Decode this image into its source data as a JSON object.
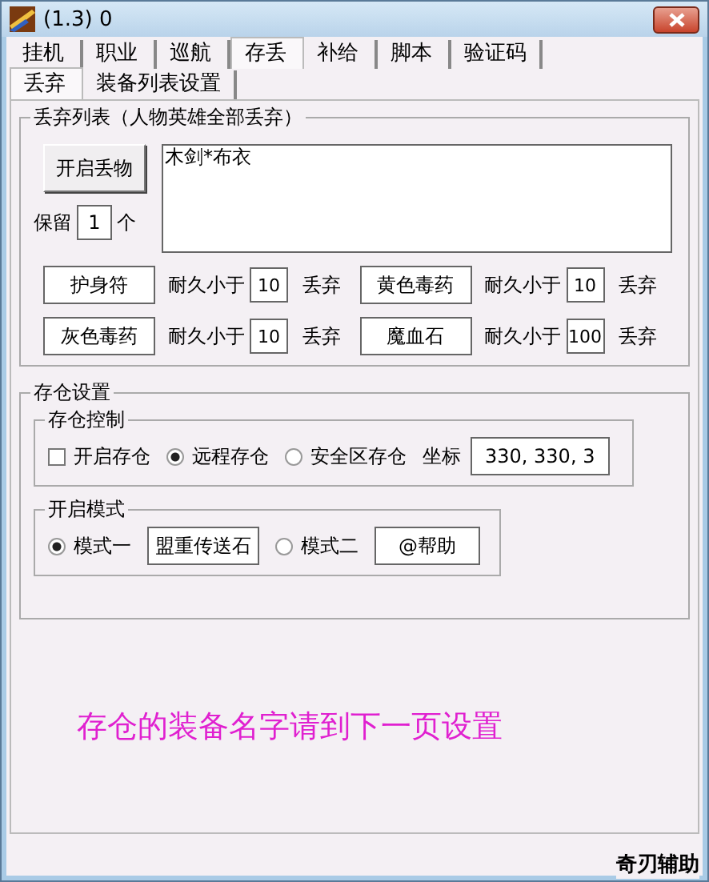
{
  "window": {
    "title": "(1.3) 0"
  },
  "tabs": [
    {
      "label": "挂机",
      "selected": false
    },
    {
      "label": "职业",
      "selected": false
    },
    {
      "label": "巡航",
      "selected": false
    },
    {
      "label": "存丢",
      "selected": true
    },
    {
      "label": "补给",
      "selected": false
    },
    {
      "label": "脚本",
      "selected": false
    },
    {
      "label": "验证码",
      "selected": false
    }
  ],
  "subtabs": [
    {
      "label": "丢弃",
      "selected": true
    },
    {
      "label": "装备列表设置",
      "selected": false
    }
  ],
  "discard_group": {
    "title": "丢弃列表（人物英雄全部丢弃）",
    "toggle_button": "开启丢物",
    "keep_label": "保留",
    "keep_value": "1",
    "keep_unit": "个",
    "list_text": "木剑*布衣",
    "rules": [
      {
        "item": "护身符",
        "condition": "耐久小于",
        "threshold": "10",
        "action": "丢弃"
      },
      {
        "item": "黄色毒药",
        "condition": "耐久小于",
        "threshold": "10",
        "action": "丢弃"
      },
      {
        "item": "灰色毒药",
        "condition": "耐久小于",
        "threshold": "10",
        "action": "丢弃"
      },
      {
        "item": "魔血石",
        "condition": "耐久小于",
        "threshold": "100",
        "action": "丢弃"
      }
    ]
  },
  "storage_group": {
    "title": "存仓设置",
    "control": {
      "title": "存仓控制",
      "enable": {
        "label": "开启存仓",
        "checked": false
      },
      "options": [
        {
          "label": "远程存仓",
          "selected": true
        },
        {
          "label": "安全区存仓",
          "selected": false
        }
      ],
      "coord_label": "坐标",
      "coord_value": "330, 330, 3"
    },
    "mode": {
      "title": "开启模式",
      "options": [
        {
          "label": "模式一",
          "selected": true,
          "value": "盟重传送石"
        },
        {
          "label": "模式二",
          "selected": false,
          "value": "@帮助"
        }
      ]
    }
  },
  "notice": "存仓的装备名字请到下一页设置",
  "brand": "奇刃辅助"
}
